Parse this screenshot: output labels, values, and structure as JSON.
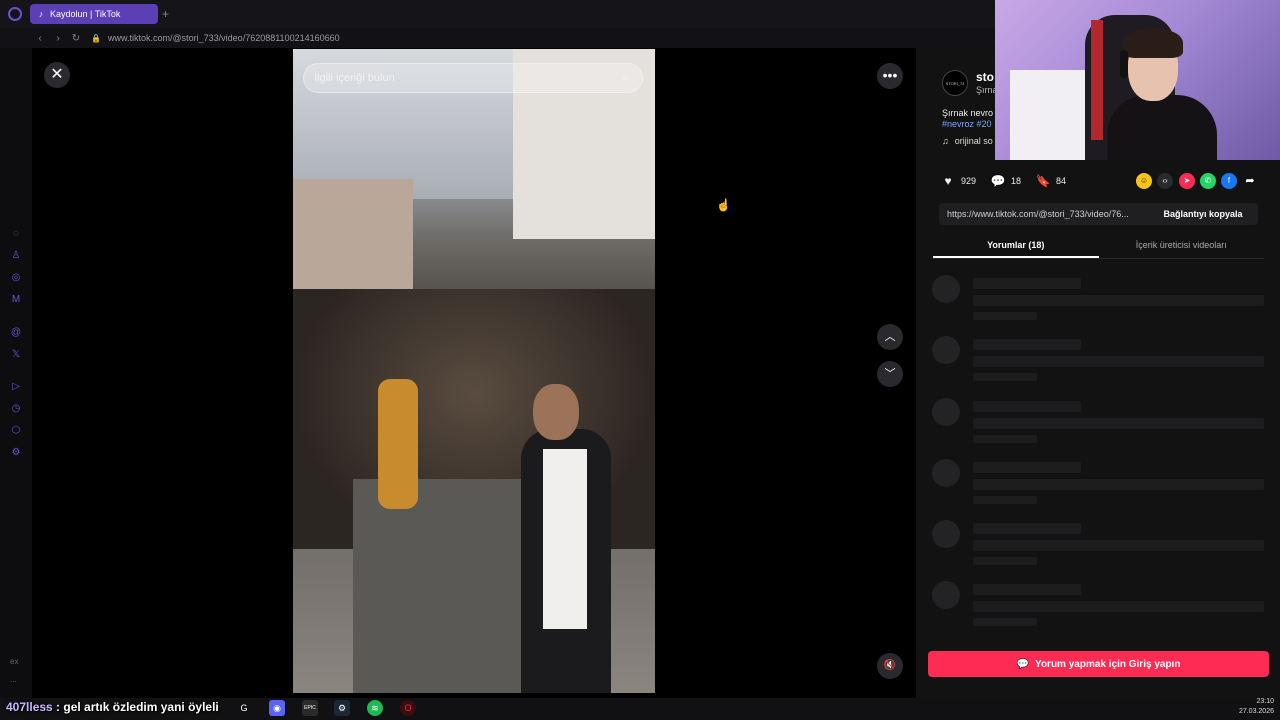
{
  "browser": {
    "tab_title": "Kaydolun | TikTok",
    "tab_icon": "tiktok-icon",
    "new_tab": "+",
    "url": "www.tiktok.com/@stori_733/video/7620881100214160660"
  },
  "video": {
    "search_placeholder": "İlgili içeriği bulun"
  },
  "author": {
    "avatar_text": "STORI_73",
    "username": "sto",
    "subtitle": "Şırna",
    "description": "Şırnak nevro",
    "tags": "#nevroz #20",
    "music": "orijinal so"
  },
  "stats": {
    "likes": "929",
    "comments": "18",
    "saves": "84"
  },
  "share_link": {
    "url": "https://www.tiktok.com/@stori_733/video/76...",
    "copy_label": "Bağlantıyı kopyala"
  },
  "tabs": {
    "comments": "Yorumlar (18)",
    "creator_videos": "İçerik üreticisi videoları"
  },
  "login_cta": "Yorum yapmak için Giriş yapın",
  "chat": {
    "user": "407lless",
    "message": " : gel artık özledim yani öyleli"
  },
  "clock": {
    "time": "23:10",
    "date": "27.03.2026"
  },
  "sidebar_bottom": {
    "label_ex": "ex",
    "label_dots": "..."
  },
  "colors": {
    "accent_tab": "#5a3fb5",
    "login_button": "#fe2c55",
    "tag_link": "#7aa7ff"
  }
}
